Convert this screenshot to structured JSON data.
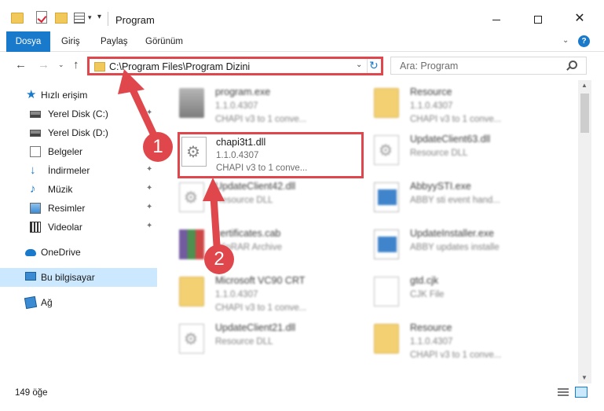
{
  "window": {
    "title": "Program",
    "minimize_icon": "minimize-icon",
    "maximize_icon": "maximize-icon",
    "close_symbol": "✕"
  },
  "ribbon": {
    "tabs": [
      "Dosya",
      "Giriş",
      "Paylaş",
      "Görünüm"
    ],
    "accent": "#1979ca",
    "help_symbol": "?"
  },
  "navigation": {
    "back_symbol": "←",
    "forward_symbol": "→",
    "recent_symbol": "⌄",
    "up_symbol": "↑",
    "address": "C:\\Program Files\\Program Dizini",
    "address_dropdown_symbol": "⌄",
    "refresh_symbol": "↻",
    "search_placeholder": "Ara: Program"
  },
  "sidebar": {
    "items": [
      {
        "label": "Hızlı erişim",
        "icon": "star-icon",
        "pinned": false
      },
      {
        "label": "Yerel Disk (C:)",
        "icon": "drive-icon",
        "pinned": true
      },
      {
        "label": "Yerel Disk (D:)",
        "icon": "drive-icon",
        "pinned": true
      },
      {
        "label": "Belgeler",
        "icon": "documents-icon",
        "pinned": true
      },
      {
        "label": "İndirmeler",
        "icon": "downloads-icon",
        "pinned": true
      },
      {
        "label": "Müzik",
        "icon": "music-icon",
        "pinned": true
      },
      {
        "label": "Resimler",
        "icon": "pictures-icon",
        "pinned": true
      },
      {
        "label": "Videolar",
        "icon": "videos-icon",
        "pinned": true
      },
      {
        "label": "OneDrive",
        "icon": "onedrive-icon",
        "pinned": false
      },
      {
        "label": "Bu bilgisayar",
        "icon": "computer-icon",
        "pinned": false,
        "selected": true
      },
      {
        "label": "Ağ",
        "icon": "network-icon",
        "pinned": false
      }
    ],
    "pin_symbol": "📌"
  },
  "files": {
    "left_column": [
      {
        "name": "program.exe",
        "version": "1.1.0.4307",
        "description": "CHAPI v3 to 1 conve...",
        "icon": "exe-icon"
      },
      {
        "name": "chapi3t1.dll",
        "version": "1.1.0.4307",
        "description": "CHAPI v3 to 1 conve...",
        "icon": "dll-icon",
        "highlighted": true
      },
      {
        "name": "UpdateClient42.dll",
        "version": "Resource DLL",
        "description": "",
        "icon": "dll-icon"
      },
      {
        "name": "certificates.cab",
        "version": "WinRAR Archive",
        "description": "",
        "icon": "archive-icon"
      },
      {
        "name": "Microsoft VC90 CRT",
        "version": "1.1.0.4307",
        "description": "CHAPI v3 to 1 conve...",
        "icon": "folder-icon"
      },
      {
        "name": "UpdateClient21.dll",
        "version": "Resource DLL",
        "description": "",
        "icon": "dll-icon"
      }
    ],
    "right_column": [
      {
        "name": "Resource",
        "version": "1.1.0.4307",
        "description": "CHAPI v3 to 1 conve...",
        "icon": "folder-icon"
      },
      {
        "name": "UpdateClient63.dll",
        "version": "Resource DLL",
        "description": "",
        "icon": "dll-icon"
      },
      {
        "name": "AbbyySTI.exe",
        "version": "ABBY sti event hand...",
        "description": "",
        "icon": "app-icon"
      },
      {
        "name": "UpdateInstaller.exe",
        "version": "ABBY updates installe",
        "description": "",
        "icon": "app-icon"
      },
      {
        "name": "gtd.cjk",
        "version": "CJK File",
        "description": "",
        "icon": "blank-file-icon"
      },
      {
        "name": "Resource",
        "version": "1.1.0.4307",
        "description": "CHAPI v3 to 1 conve...",
        "icon": "folder-icon"
      }
    ]
  },
  "status": {
    "item_count": "149 öğe"
  },
  "annotations": {
    "step_1": "1",
    "step_2": "2",
    "color": "#e0474c"
  }
}
